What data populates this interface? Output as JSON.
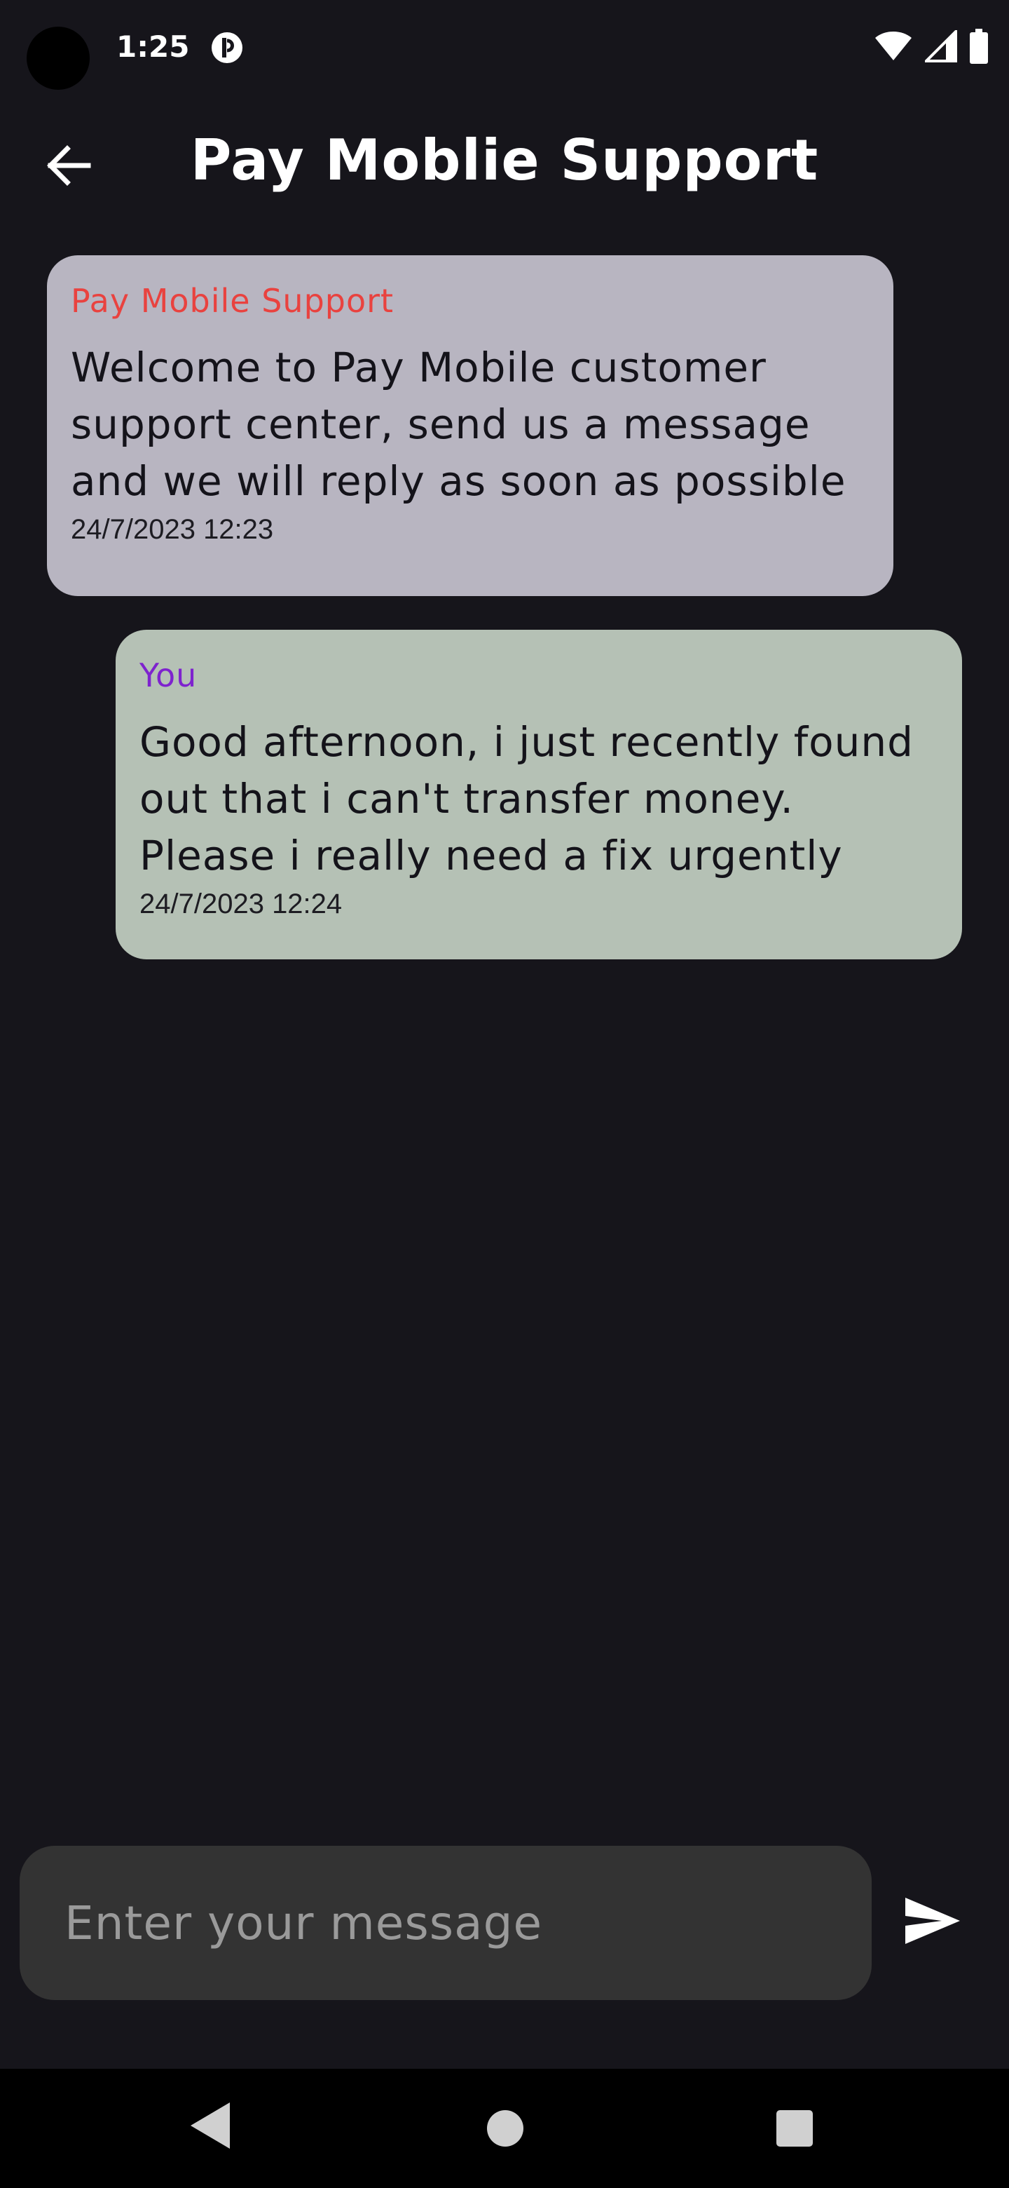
{
  "status_bar": {
    "time": "1:25",
    "icons": [
      "camera-hole",
      "app-notification-icon",
      "wifi-icon",
      "signal-icon",
      "battery-icon"
    ]
  },
  "app_bar": {
    "title": "Pay Moblie Support",
    "back_icon": "arrow-left-icon"
  },
  "messages": [
    {
      "sender": "Pay Mobile Support",
      "text": "Welcome to Pay Mobile customer support center, send us a message and we will reply as soon as possible",
      "time": "24/7/2023 12:23",
      "sender_color": "#e9423f",
      "bubble_color": "#b8b5c1"
    },
    {
      "sender": "You",
      "text": "Good afternoon, i just recently found out that i can't transfer money. Please i really need a fix urgently",
      "time": "24/7/2023 12:24",
      "sender_color": "#7e22ce",
      "bubble_color": "#b5c1b5"
    }
  ],
  "composer": {
    "placeholder": "Enter your message",
    "value": "",
    "send_icon": "send-icon"
  },
  "nav_bar": {
    "icons": [
      "nav-back-icon",
      "nav-home-icon",
      "nav-recents-icon"
    ]
  },
  "colors": {
    "background": "#16151b",
    "input_background": "#333333",
    "nav_background": "#000000"
  }
}
